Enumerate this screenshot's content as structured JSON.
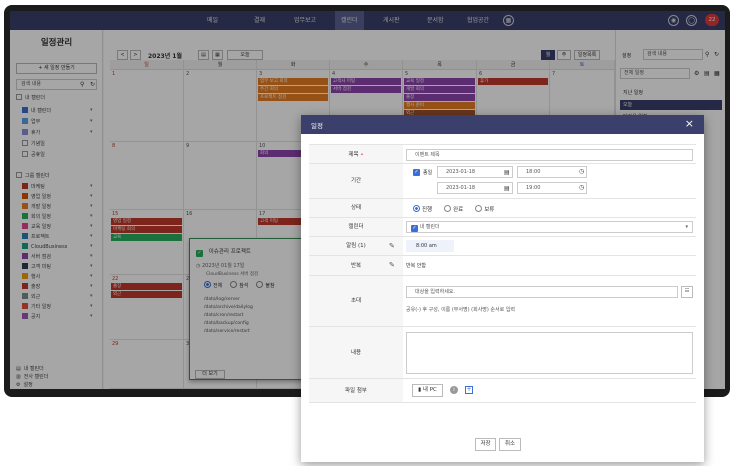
{
  "topnav": {
    "items": [
      {
        "label": "메일"
      },
      {
        "label": "결재"
      },
      {
        "label": "업무보고"
      },
      {
        "label": "캘린더",
        "active": true
      },
      {
        "label": "게시판"
      },
      {
        "label": "문서함"
      },
      {
        "label": "협업공간"
      }
    ],
    "badge": "22"
  },
  "sidebar": {
    "title": "일정관리",
    "add_button": "+ 새 일정 만들기",
    "search_placeholder": "검색 내용",
    "my_calendars_label": "내 캘린더",
    "my_calendars": [
      {
        "label": "내 캘린더",
        "color": "#3b6fd6",
        "checked": true
      },
      {
        "label": "업무",
        "color": "#5aa0e6",
        "checked": true
      },
      {
        "label": "휴가",
        "color": "#8a8fd6",
        "checked": true
      },
      {
        "label": "기념일",
        "color": "#ffffff",
        "checked": false
      },
      {
        "label": "공휴일",
        "color": "#ffffff",
        "checked": false
      }
    ],
    "group_calendars_label": "그룹 캘린더",
    "group_calendars": [
      {
        "label": "마케팅",
        "color": "#c0392b"
      },
      {
        "label": "영업 일정",
        "color": "#d35400"
      },
      {
        "label": "개발 일정",
        "color": "#e67e22"
      },
      {
        "label": "회의 일정",
        "color": "#27ae60"
      },
      {
        "label": "교육 일정",
        "color": "#e84393"
      },
      {
        "label": "프로젝트",
        "color": "#2980b9"
      },
      {
        "label": "CloudBusiness",
        "color": "#16a085"
      },
      {
        "label": "서버 점검",
        "color": "#8e44ad"
      },
      {
        "label": "고객 미팅",
        "color": "#2c3e50"
      },
      {
        "label": "행사",
        "color": "#f39c12"
      },
      {
        "label": "출장",
        "color": "#c0392b"
      },
      {
        "label": "외근",
        "color": "#7f8c8d"
      },
      {
        "label": "기타 일정",
        "color": "#e74c3c"
      },
      {
        "label": "공지",
        "color": "#9b59b6"
      }
    ],
    "bottom_links": [
      {
        "label": "내 캘린더"
      },
      {
        "label": "전사 캘린더"
      },
      {
        "label": "설정"
      }
    ]
  },
  "toolbar": {
    "prev": "<",
    "next": ">",
    "month_title": "2023년 1월",
    "today": "오늘",
    "view_day": "일",
    "view_week": "주",
    "view_month": "월",
    "view_list": "일정목록"
  },
  "calendar": {
    "weekdays": [
      "일",
      "월",
      "화",
      "수",
      "목",
      "금",
      "토"
    ],
    "weeks": [
      [
        "1",
        "2",
        "3",
        "4",
        "5",
        "6",
        "7"
      ],
      [
        "8",
        "9",
        "10",
        "11",
        "12",
        "13",
        "14"
      ],
      [
        "15",
        "16",
        "17",
        "18",
        "19",
        "20",
        "21"
      ],
      [
        "22",
        "23",
        "24",
        "25",
        "26",
        "27",
        "28"
      ],
      [
        "29",
        "30",
        "31",
        "",
        "",
        "",
        ""
      ]
    ],
    "events": [
      {
        "week": 0,
        "day": 2,
        "slot": 0,
        "text": "업무 보고 회의",
        "color": "#e67e22"
      },
      {
        "week": 0,
        "day": 2,
        "slot": 1,
        "text": "주간 회의",
        "color": "#e67e22"
      },
      {
        "week": 0,
        "day": 2,
        "slot": 2,
        "text": "프로젝트 점검",
        "color": "#e67e22"
      },
      {
        "week": 0,
        "day": 3,
        "slot": 0,
        "text": "고객사 미팅",
        "color": "#8e44ad"
      },
      {
        "week": 0,
        "day": 3,
        "slot": 1,
        "text": "서버 점검",
        "color": "#8e44ad"
      },
      {
        "week": 0,
        "day": 4,
        "slot": 0,
        "text": "교육 일정",
        "color": "#8e44ad"
      },
      {
        "week": 0,
        "day": 5,
        "slot": 0,
        "text": "휴가",
        "color": "#c0392b"
      },
      {
        "week": 0,
        "day": 4,
        "slot": 1,
        "text": "개발 회의",
        "color": "#8e44ad"
      },
      {
        "week": 0,
        "day": 4,
        "slot": 2,
        "text": "출장",
        "color": "#8e44ad"
      },
      {
        "week": 0,
        "day": 4,
        "slot": 3,
        "text": "행사 준비",
        "color": "#e67e22"
      },
      {
        "week": 0,
        "day": 4,
        "slot": 4,
        "text": "외근",
        "color": "#a0522d"
      },
      {
        "week": 1,
        "day": 2,
        "slot": 0,
        "text": "회의",
        "color": "#8e44ad"
      },
      {
        "week": 1,
        "day": 3,
        "slot": 0,
        "text": "업무 보고",
        "color": "#e67e22"
      },
      {
        "week": 2,
        "day": 0,
        "slot": 0,
        "text": "영업 일정",
        "color": "#c0392b"
      },
      {
        "week": 2,
        "day": 0,
        "slot": 1,
        "text": "마케팅 회의",
        "color": "#c0392b"
      },
      {
        "week": 2,
        "day": 0,
        "slot": 2,
        "text": "교육",
        "color": "#27ae60"
      },
      {
        "week": 2,
        "day": 2,
        "slot": 0,
        "text": "고객 미팅",
        "color": "#c0392b"
      },
      {
        "week": 3,
        "day": 0,
        "slot": 0,
        "text": "출장",
        "color": "#c0392b"
      },
      {
        "week": 3,
        "day": 0,
        "slot": 1,
        "text": "외근",
        "color": "#c0392b"
      }
    ]
  },
  "popup": {
    "title": "이슈관리 프로젝트",
    "date": "2023년 01월 17일",
    "desc": "CloudBusiness 서버 점검",
    "options": [
      "전체",
      "참석",
      "불참"
    ],
    "lines": [
      "/data/log/server",
      "/data/archive/dailylog",
      "/data/cron/restart",
      "/data/backup/config",
      "/data/service/restart"
    ],
    "more": "더 보기"
  },
  "rightpane": {
    "setting_label": "설정",
    "search_placeholder": "검색 내용",
    "filter_label": "전체 일정",
    "items": [
      "지난 일정",
      "오늘",
      "다가올 일정"
    ]
  },
  "modal": {
    "title": "일정",
    "close": "×",
    "subject_label": "제목",
    "subject_placeholder": "이벤트 제목",
    "period_label": "기간",
    "allday_label": "종일",
    "start_date": "2023-01-18",
    "start_time": "18:00",
    "end_date": "2023-01-18",
    "end_time": "19:00",
    "status_label": "상태",
    "status_options": [
      "진행",
      "완료",
      "보류"
    ],
    "calendar_label": "캘린더",
    "calendar_value": "내 캘린더",
    "alarm_label": "알림 (1)",
    "alarm_value": "8:00 am",
    "repeat_label": "반복",
    "repeat_value": "반복 안함",
    "invite_label": "초대",
    "invite_placeholder": "대상을 입력하세요.",
    "invite_hint": "공유(-) 후 구성, 이름 (부서명) (회사명) 순서로 입력",
    "content_label": "내용",
    "attach_label": "파일 첨부",
    "attach_button": "내 PC",
    "save": "저장",
    "cancel": "취소"
  }
}
